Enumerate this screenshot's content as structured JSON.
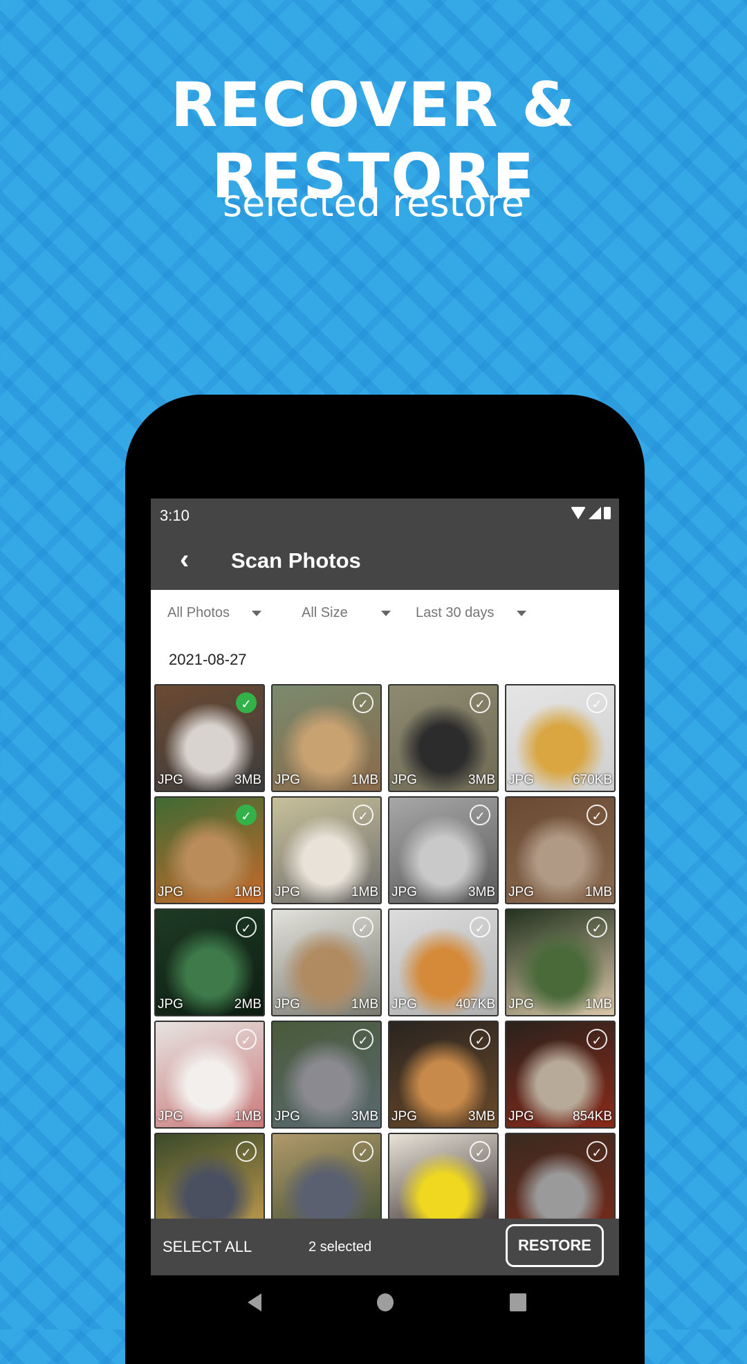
{
  "promo": {
    "headline": "RECOVER & RESTORE",
    "subline": "selected restore"
  },
  "status_bar": {
    "time": "3:10",
    "icons": [
      "wifi-icon",
      "signal-icon",
      "battery-icon"
    ]
  },
  "app_bar": {
    "back_icon": "‹",
    "title": "Scan Photos"
  },
  "filters": [
    {
      "label": "All Photos"
    },
    {
      "label": "All Size"
    },
    {
      "label": "Last 30 days"
    }
  ],
  "date_header": "2021-08-27",
  "photos": [
    {
      "ext": "JPG",
      "size": "3MB",
      "selected": true,
      "subject": "dogs sleeping on bed",
      "colors": [
        "#6b4a33",
        "#d9d3cf",
        "#3c3c3c"
      ]
    },
    {
      "ext": "JPG",
      "size": "1MB",
      "selected": false,
      "subject": "golden retriever petted",
      "colors": [
        "#7a8a6e",
        "#c9a272",
        "#8a6a4a"
      ]
    },
    {
      "ext": "JPG",
      "size": "3MB",
      "selected": false,
      "subject": "border collie with ball",
      "colors": [
        "#8d8a70",
        "#2c2c2c",
        "#6e6a55"
      ]
    },
    {
      "ext": "JPG",
      "size": "670KB",
      "selected": false,
      "subject": "lemon drink",
      "colors": [
        "#e5e5e5",
        "#d9a642",
        "#cfcfcf"
      ]
    },
    {
      "ext": "JPG",
      "size": "1MB",
      "selected": true,
      "subject": "two puppies",
      "colors": [
        "#3f6a34",
        "#b98c5a",
        "#c76a2a"
      ]
    },
    {
      "ext": "JPG",
      "size": "1MB",
      "selected": false,
      "subject": "dog sleeping in sun",
      "colors": [
        "#c8c09a",
        "#e8e2d8",
        "#6e6e6e"
      ]
    },
    {
      "ext": "JPG",
      "size": "3MB",
      "selected": false,
      "subject": "tabby kitten on blanket",
      "colors": [
        "#a7a7a7",
        "#c9c9c9",
        "#5a5a5a"
      ]
    },
    {
      "ext": "JPG",
      "size": "1MB",
      "selected": false,
      "subject": "cat on armchair",
      "colors": [
        "#6a4a32",
        "#b09a86",
        "#8a6a50"
      ]
    },
    {
      "ext": "JPG",
      "size": "2MB",
      "selected": false,
      "subject": "palm leaves",
      "colors": [
        "#1d3a24",
        "#3e7a4a",
        "#0e1e12"
      ]
    },
    {
      "ext": "JPG",
      "size": "1MB",
      "selected": false,
      "subject": "cat looking down",
      "colors": [
        "#e2e2dc",
        "#b08a60",
        "#7a7a70"
      ]
    },
    {
      "ext": "JPG",
      "size": "407KB",
      "selected": false,
      "subject": "orange cat",
      "colors": [
        "#dcdcdc",
        "#d58a3a",
        "#b0b0b0"
      ]
    },
    {
      "ext": "JPG",
      "size": "1MB",
      "selected": false,
      "subject": "woman with plant",
      "colors": [
        "#23331f",
        "#4a6a3a",
        "#d9c6a8"
      ]
    },
    {
      "ext": "JPG",
      "size": "1MB",
      "selected": false,
      "subject": "white dog with flowers",
      "colors": [
        "#e6e3e0",
        "#f2efec",
        "#c97a7a"
      ]
    },
    {
      "ext": "JPG",
      "size": "3MB",
      "selected": false,
      "subject": "grey scottish fold cat",
      "colors": [
        "#4a5a3a",
        "#8a8a90",
        "#5a6a70"
      ]
    },
    {
      "ext": "JPG",
      "size": "3MB",
      "selected": false,
      "subject": "golden retriever smiling",
      "colors": [
        "#2a2420",
        "#c88a4a",
        "#6a4a2a"
      ]
    },
    {
      "ext": "JPG",
      "size": "854KB",
      "selected": false,
      "subject": "cat with crown",
      "colors": [
        "#2a221c",
        "#b8aa98",
        "#8a2a1a"
      ]
    },
    {
      "ext": "",
      "size": "",
      "selected": false,
      "subject": "grey cat bokeh",
      "colors": [
        "#3a4a2a",
        "#4a5060",
        "#c9a050"
      ]
    },
    {
      "ext": "",
      "size": "",
      "selected": false,
      "subject": "grey cat sitting",
      "colors": [
        "#b09a6a",
        "#5a6070",
        "#3a4a30"
      ]
    },
    {
      "ext": "",
      "size": "",
      "selected": false,
      "subject": "woman yellow shirt",
      "colors": [
        "#e8e2d8",
        "#f0d820",
        "#2a2020"
      ]
    },
    {
      "ext": "",
      "size": "",
      "selected": false,
      "subject": "tabby white cat",
      "colors": [
        "#3a2a20",
        "#9a9a9a",
        "#7a2a1a"
      ]
    }
  ],
  "bottom_bar": {
    "select_all": "SELECT ALL",
    "selected_count": "2 selected",
    "restore": "RESTORE"
  },
  "check_glyph": "✓"
}
